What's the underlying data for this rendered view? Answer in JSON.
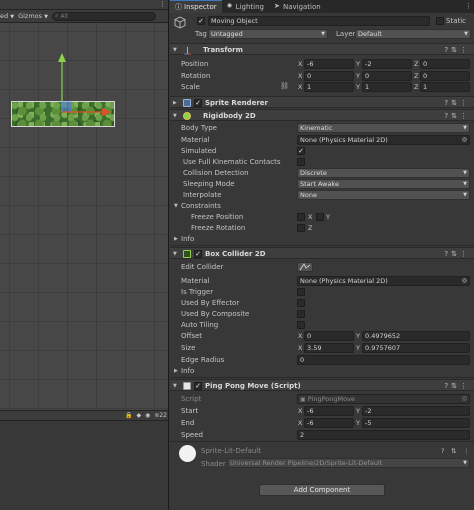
{
  "scene": {
    "shaded_label": "ed",
    "gizmos_label": "Gizmos",
    "search_placeholder": "All",
    "layers_count": "22"
  },
  "tabs": [
    {
      "label": "Inspector",
      "active": true
    },
    {
      "label": "Lighting",
      "active": false
    },
    {
      "label": "Navigation",
      "active": false
    }
  ],
  "object": {
    "name": "Moving Object",
    "active": true,
    "static_label": "Static",
    "tag_label": "Tag",
    "tag_value": "Untagged",
    "layer_label": "Layer",
    "layer_value": "Default"
  },
  "transform": {
    "title": "Transform",
    "position_label": "Position",
    "position": {
      "x": "-6",
      "y": "-2",
      "z": "0"
    },
    "rotation_label": "Rotation",
    "rotation": {
      "x": "0",
      "y": "0",
      "z": "0"
    },
    "scale_label": "Scale",
    "scale": {
      "x": "1",
      "y": "1",
      "z": "1"
    }
  },
  "sprite_renderer": {
    "title": "Sprite Renderer"
  },
  "rigidbody": {
    "title": "Rigidbody 2D",
    "body_type_label": "Body Type",
    "body_type": "Kinematic",
    "material_label": "Material",
    "material": "None (Physics Material 2D)",
    "simulated_label": "Simulated",
    "full_kinematic_label": "Use Full Kinematic Contacts",
    "collision_label": "Collision Detection",
    "collision": "Discrete",
    "sleeping_label": "Sleeping Mode",
    "sleeping": "Start Awake",
    "interpolate_label": "Interpolate",
    "interpolate": "None",
    "constraints_label": "Constraints",
    "freeze_position_label": "Freeze Position",
    "freeze_rotation_label": "Freeze Rotation",
    "info_label": "Info"
  },
  "box_collider": {
    "title": "Box Collider 2D",
    "edit_collider_label": "Edit Collider",
    "material_label": "Material",
    "material": "None (Physics Material 2D)",
    "is_trigger_label": "Is Trigger",
    "used_by_effector_label": "Used By Effector",
    "used_by_composite_label": "Used By Composite",
    "auto_tiling_label": "Auto Tiling",
    "offset_label": "Offset",
    "offset": {
      "x": "0",
      "y": "0.4979652"
    },
    "size_label": "Size",
    "size": {
      "x": "3.59",
      "y": "0.9757607"
    },
    "edge_radius_label": "Edge Radius",
    "edge_radius": "0",
    "info_label": "Info"
  },
  "ping_pong": {
    "title": "Ping Pong Move (Script)",
    "script_label": "Script",
    "script_value": "PingPongMove",
    "start_label": "Start",
    "start": {
      "x": "-6",
      "y": "-2"
    },
    "end_label": "End",
    "end": {
      "x": "-6",
      "y": "-5"
    },
    "speed_label": "Speed",
    "speed": "2"
  },
  "material": {
    "name": "Sprite-Lit-Default",
    "shader_label": "Shader",
    "shader_value": "Universal Render Pipeline/2D/Sprite-Lit-Default"
  },
  "add_component_label": "Add Component",
  "axis": {
    "x": "X",
    "y": "Y",
    "z": "Z"
  },
  "colors": {
    "accent": "#3a79bb",
    "background": "#383838",
    "field": "#2a2a2a",
    "header": "#3e3e3e"
  }
}
